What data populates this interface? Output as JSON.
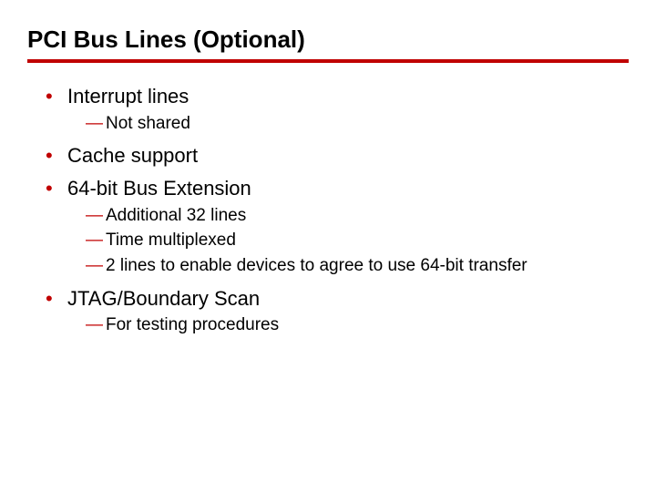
{
  "title": "PCI Bus Lines (Optional)",
  "b1": {
    "text": "Interrupt lines",
    "sub": {
      "s1": "Not shared"
    }
  },
  "b2": {
    "text": "Cache support"
  },
  "b3": {
    "text": "64-bit Bus Extension",
    "sub": {
      "s1": "Additional 32 lines",
      "s2": "Time multiplexed",
      "s3": " 2 lines to enable devices to agree to use 64-bit transfer"
    }
  },
  "b4": {
    "text": "JTAG/Boundary Scan",
    "sub": {
      "s1": "For testing procedures"
    }
  }
}
